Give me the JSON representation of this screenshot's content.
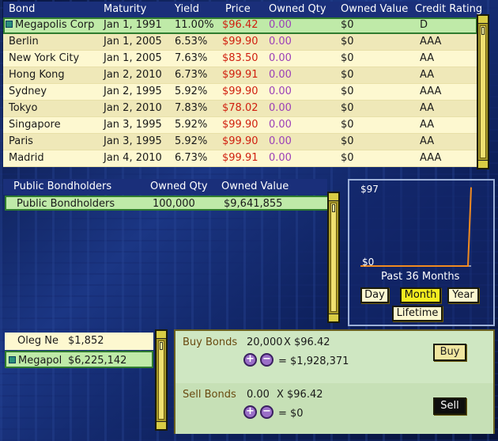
{
  "bond_table": {
    "headers": {
      "bond": "Bond",
      "maturity": "Maturity",
      "yield": "Yield",
      "price": "Price",
      "owned_qty": "Owned Qty",
      "owned_value": "Owned Value",
      "credit_rating": "Credit Rating"
    },
    "rows": [
      {
        "bond": "Megapolis Corp",
        "maturity": "Jan 1, 1991",
        "yield": "11.00%",
        "price": "$96.42",
        "owned_qty": "0.00",
        "owned_value": "$0",
        "credit_rating": "D"
      },
      {
        "bond": "Berlin",
        "maturity": "Jan 1, 2005",
        "yield": "6.53%",
        "price": "$99.90",
        "owned_qty": "0.00",
        "owned_value": "$0",
        "credit_rating": "AAA"
      },
      {
        "bond": "New York City",
        "maturity": "Jan 1, 2005",
        "yield": "7.63%",
        "price": "$83.50",
        "owned_qty": "0.00",
        "owned_value": "$0",
        "credit_rating": "AA"
      },
      {
        "bond": "Hong Kong",
        "maturity": "Jan 2, 2010",
        "yield": "6.73%",
        "price": "$99.91",
        "owned_qty": "0.00",
        "owned_value": "$0",
        "credit_rating": "AA"
      },
      {
        "bond": "Sydney",
        "maturity": "Jan 2, 1995",
        "yield": "5.92%",
        "price": "$99.90",
        "owned_qty": "0.00",
        "owned_value": "$0",
        "credit_rating": "AAA"
      },
      {
        "bond": "Tokyo",
        "maturity": "Jan 2, 2010",
        "yield": "7.83%",
        "price": "$78.02",
        "owned_qty": "0.00",
        "owned_value": "$0",
        "credit_rating": "AA"
      },
      {
        "bond": "Singapore",
        "maturity": "Jan 3, 1995",
        "yield": "5.92%",
        "price": "$99.90",
        "owned_qty": "0.00",
        "owned_value": "$0",
        "credit_rating": "AA"
      },
      {
        "bond": "Paris",
        "maturity": "Jan 3, 1995",
        "yield": "5.92%",
        "price": "$99.90",
        "owned_qty": "0.00",
        "owned_value": "$0",
        "credit_rating": "AA"
      },
      {
        "bond": "Madrid",
        "maturity": "Jan 4, 2010",
        "yield": "6.73%",
        "price": "$99.91",
        "owned_qty": "0.00",
        "owned_value": "$0",
        "credit_rating": "AAA"
      }
    ]
  },
  "bondholders": {
    "headers": {
      "holder": "Public Bondholders",
      "owned_qty": "Owned Qty",
      "owned_value": "Owned Value"
    },
    "rows": [
      {
        "holder": "Public Bondholders",
        "owned_qty": "100,000",
        "owned_value": "$9,641,855"
      }
    ]
  },
  "price_graph": {
    "top_label": "$97",
    "bottom_label": "$0",
    "caption": "Past 36 Months",
    "buttons": {
      "day": "Day",
      "month": "Month",
      "year": "Year",
      "lifetime": "Lifetime"
    },
    "active_range": "Month"
  },
  "chart_data": {
    "type": "line",
    "title": "",
    "xlabel": "Past 36 Months",
    "ylabel": "",
    "ylim": [
      0,
      97
    ],
    "series": [
      {
        "values": [
          0,
          0,
          0,
          0,
          0,
          0,
          0,
          0,
          0,
          0,
          0,
          0,
          0,
          0,
          0,
          0,
          0,
          0,
          0,
          0,
          0,
          0,
          0,
          0,
          0,
          0,
          0,
          0,
          0,
          0,
          0,
          0,
          0,
          0,
          0,
          96.42
        ],
        "color": "#f08a20"
      }
    ]
  },
  "players": [
    {
      "name": "Oleg Ne",
      "amount": "$1,852",
      "selected": false
    },
    {
      "name": "Megapol",
      "amount": "$6,225,142",
      "selected": true
    }
  ],
  "trade": {
    "buy": {
      "label": "Buy Bonds",
      "qty": "20,000",
      "x": "X",
      "price": "$96.42",
      "total": "= $1,928,371",
      "button": "Buy"
    },
    "sell": {
      "label": "Sell Bonds",
      "qty": "0.00",
      "x": "X",
      "price": "$96.42",
      "total": "= $0",
      "button": "Sell"
    },
    "plus": "+",
    "minus": "−"
  },
  "colors": {
    "header_bg": "#1a2f7a",
    "row_bg": "#fdf8d0",
    "selected_row": "#bfeaa8",
    "price_red": "#d02010",
    "qty_purple": "#9b3fb8",
    "graph_line": "#f08a20",
    "active_button": "#f4ec20"
  }
}
